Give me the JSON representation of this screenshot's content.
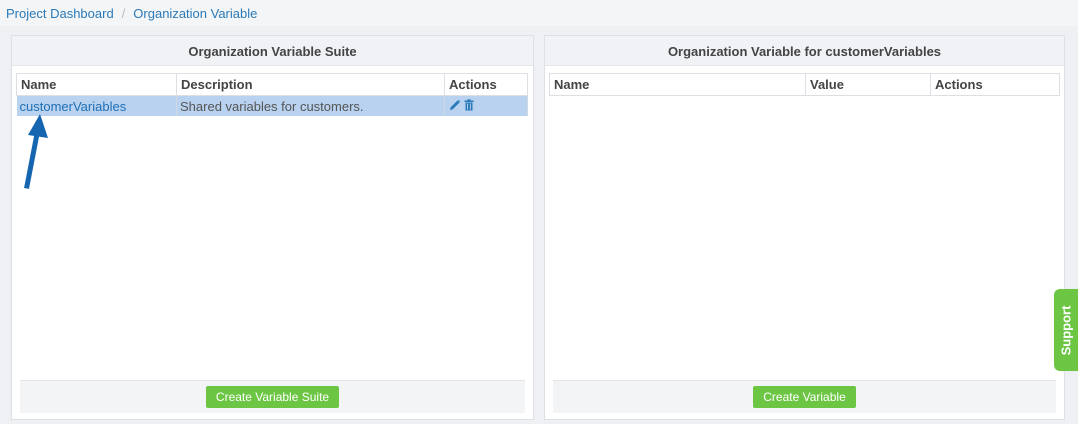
{
  "breadcrumb": {
    "items": [
      "Project Dashboard",
      "Organization Variable"
    ],
    "separator": "/"
  },
  "left_panel": {
    "title": "Organization Variable Suite",
    "columns": {
      "name": "Name",
      "description": "Description",
      "actions": "Actions"
    },
    "rows": [
      {
        "name": "customerVariables",
        "description": "Shared variables for customers.",
        "selected": true,
        "actions": [
          "edit-icon",
          "delete-icon"
        ]
      }
    ],
    "footer_button": "Create Variable Suite"
  },
  "right_panel": {
    "title": "Organization Variable for customerVariables",
    "columns": {
      "name": "Name",
      "value": "Value",
      "actions": "Actions"
    },
    "rows": [],
    "footer_button": "Create Variable"
  },
  "support_tab": {
    "label": "Support"
  },
  "colors": {
    "link": "#2a7ab9",
    "selected_row": "#b8d2ef",
    "button_green": "#6cc644",
    "arrow_blue": "#1565b0"
  }
}
